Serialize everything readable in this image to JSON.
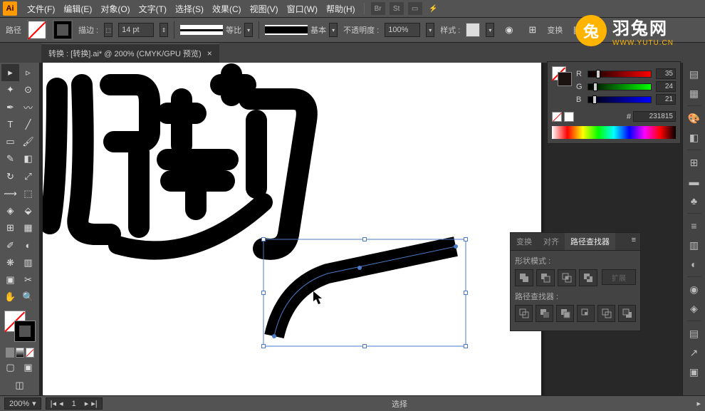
{
  "menu": {
    "file": "文件(F)",
    "edit": "编辑(E)",
    "object": "对象(O)",
    "type": "文字(T)",
    "select": "选择(S)",
    "effect": "效果(C)",
    "view": "视图(V)",
    "window": "窗口(W)",
    "help": "帮助(H)"
  },
  "control": {
    "label": "路径",
    "stroke_label": "描边 :",
    "stroke_weight": "14 pt",
    "profile_label": "等比",
    "brush_label": "基本",
    "opacity_label": "不透明度 :",
    "opacity_value": "100%",
    "style_label": "样式 :",
    "transform_label": "变换"
  },
  "document": {
    "tab_title": "转换 : [转换].ai* @ 200% (CMYK/GPU 预览)"
  },
  "color_panel": {
    "channels": {
      "r": {
        "label": "R",
        "value": "35"
      },
      "g": {
        "label": "G",
        "value": "24"
      },
      "b": {
        "label": "B",
        "value": "21"
      }
    },
    "hex_value": "231815"
  },
  "pathfinder": {
    "tab_transform": "变换",
    "tab_align": "对齐",
    "tab_pathfinder": "路径查找器",
    "shape_modes_label": "形状模式 :",
    "expand_label": "扩展",
    "pathfinders_label": "路径查找器 :"
  },
  "status": {
    "zoom": "200%",
    "nav_page": "1",
    "tool": "选择"
  },
  "watermark": {
    "title": "羽兔网",
    "url": "WWW.YUTU.CN"
  }
}
